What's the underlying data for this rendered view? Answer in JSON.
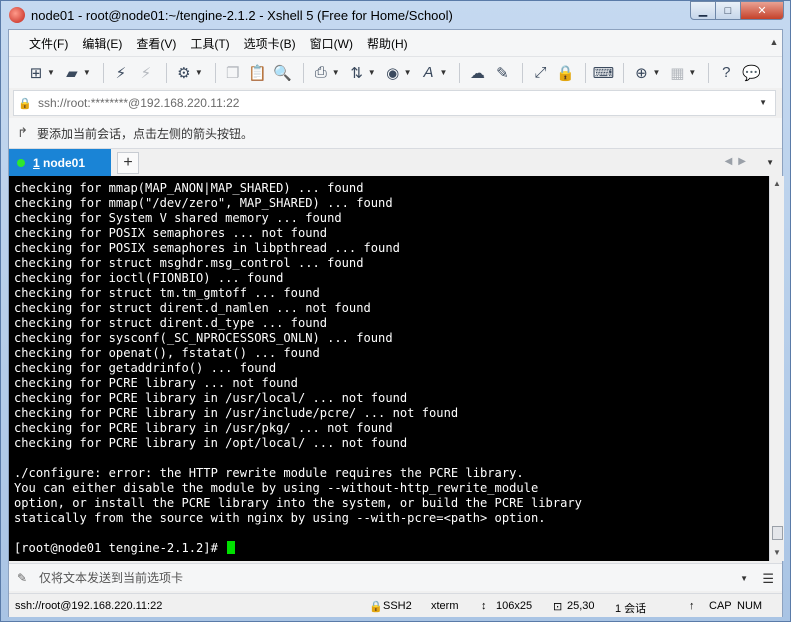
{
  "window": {
    "title": "node01 - root@node01:~/tengine-2.1.2 - Xshell 5 (Free for Home/School)",
    "min_label": "▁",
    "max_label": "□",
    "close_label": "✕"
  },
  "menu": [
    "文件(F)",
    "编辑(E)",
    "查看(V)",
    "工具(T)",
    "选项卡(B)",
    "窗口(W)",
    "帮助(H)"
  ],
  "address": {
    "value": "ssh://root:********@192.168.220.11:22"
  },
  "hint": {
    "text": "要添加当前会话，点击左侧的箭头按钮。"
  },
  "tab": {
    "number": "1",
    "name": " node01",
    "add_label": "+"
  },
  "terminal": {
    "lines": [
      "checking for mmap(MAP_ANON|MAP_SHARED) ... found",
      "checking for mmap(\"/dev/zero\", MAP_SHARED) ... found",
      "checking for System V shared memory ... found",
      "checking for POSIX semaphores ... not found",
      "checking for POSIX semaphores in libpthread ... found",
      "checking for struct msghdr.msg_control ... found",
      "checking for ioctl(FIONBIO) ... found",
      "checking for struct tm.tm_gmtoff ... found",
      "checking for struct dirent.d_namlen ... not found",
      "checking for struct dirent.d_type ... found",
      "checking for sysconf(_SC_NPROCESSORS_ONLN) ... found",
      "checking for openat(), fstatat() ... found",
      "checking for getaddrinfo() ... found",
      "checking for PCRE library ... not found",
      "checking for PCRE library in /usr/local/ ... not found",
      "checking for PCRE library in /usr/include/pcre/ ... not found",
      "checking for PCRE library in /usr/pkg/ ... not found",
      "checking for PCRE library in /opt/local/ ... not found",
      "",
      "./configure: error: the HTTP rewrite module requires the PCRE library.",
      "You can either disable the module by using --without-http_rewrite_module",
      "option, or install the PCRE library into the system, or build the PCRE library",
      "statically from the source with nginx by using --with-pcre=<path> option.",
      ""
    ],
    "prompt": "[root@node01 tengine-2.1.2]# ",
    "text_color": "#ffffff",
    "background": "#000000",
    "cursor_color": "#00e000"
  },
  "send": {
    "placeholder": "仅将文本发送到当前选项卡"
  },
  "status": {
    "connection": "ssh://root@192.168.220.11:22",
    "protocol": "SSH2",
    "terminal_type": "xterm",
    "size": "106x25",
    "position": "25,30",
    "sessions": "1 会话",
    "cap": "CAP",
    "num": "NUM"
  },
  "colors": {
    "tab_active": "#1a84d6",
    "tab_dot": "#2ee82e"
  }
}
